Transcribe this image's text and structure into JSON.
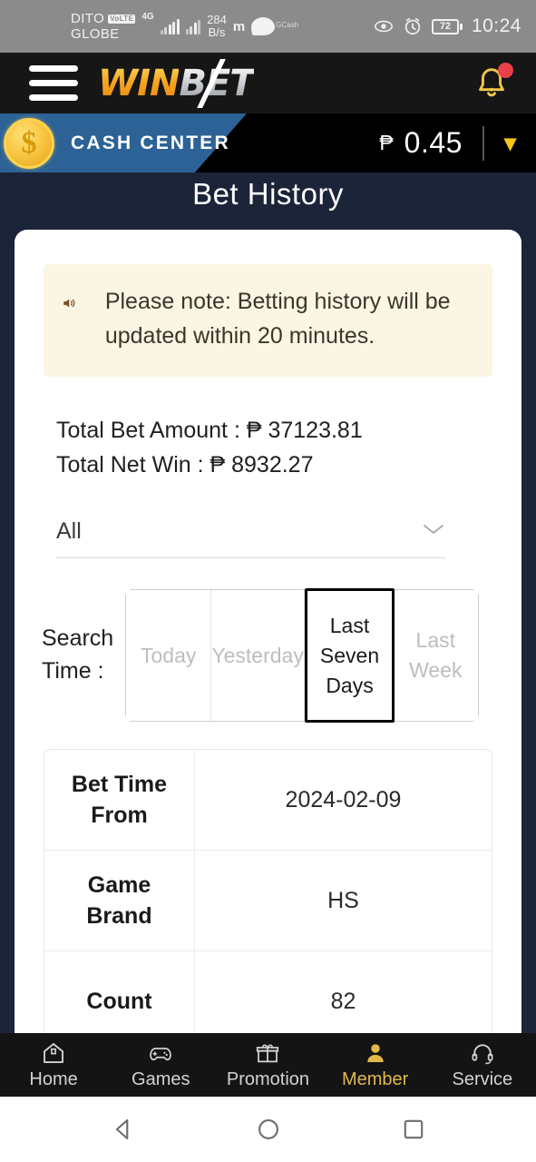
{
  "statusbar": {
    "carrier_primary": "DITO",
    "carrier_secondary": "GLOBE",
    "volte_badge": "VoLTE",
    "network_type": "4G",
    "data_rate": "284",
    "data_rate_unit": "B/s",
    "m_icon_label": "m",
    "gcash_label": "GCash",
    "battery_percent": "72",
    "time": "10:24",
    "icons": {
      "eye": "eye-icon",
      "alarm": "alarm-clock-icon",
      "battery": "battery-icon"
    }
  },
  "header": {
    "menu_icon": "hamburger-menu-icon",
    "logo_part1": "WIN",
    "logo_part2": "BET",
    "bell_icon": "notification-bell-icon",
    "has_notification": true
  },
  "cash_center": {
    "label": "CASH CENTER",
    "coin_symbol": "$",
    "currency_symbol": "₱",
    "balance": "0.45",
    "chevron": "▾"
  },
  "page": {
    "title": "Bet History"
  },
  "notice": {
    "icon": "speaker-announcement-icon",
    "text": "Please note: Betting history will be updated within 20 minutes."
  },
  "totals": {
    "bet_amount_line": "Total Bet Amount : ₱ 37123.81",
    "net_win_line": "Total Net Win : ₱ 8932.27",
    "bet_amount_label": "Total Bet Amount",
    "bet_amount_value": "37123.81",
    "net_win_label": "Total Net Win",
    "net_win_value": "8932.27"
  },
  "filter": {
    "selected": "All",
    "chevron": "⌄"
  },
  "search_time": {
    "label": "Search Time :",
    "options": [
      {
        "label": "Today",
        "active": false
      },
      {
        "label": "Yesterday",
        "active": false
      },
      {
        "label": "Last Seven Days",
        "active": true
      },
      {
        "label": "Last Week",
        "active": false
      }
    ]
  },
  "table": {
    "rows": [
      {
        "header": "Bet Time From",
        "value": "2024-02-09"
      },
      {
        "header": "Game Brand",
        "value": "HS"
      },
      {
        "header": "Count",
        "value": "82"
      }
    ]
  },
  "bottom_nav": {
    "items": [
      {
        "label": "Home",
        "icon": "home-icon",
        "active": false
      },
      {
        "label": "Games",
        "icon": "gamepad-icon",
        "active": false
      },
      {
        "label": "Promotion",
        "icon": "gift-icon",
        "active": false
      },
      {
        "label": "Member",
        "icon": "user-icon",
        "active": true
      },
      {
        "label": "Service",
        "icon": "headset-icon",
        "active": false
      }
    ]
  },
  "android_nav": {
    "back": "back-triangle-icon",
    "home": "home-circle-icon",
    "recents": "recents-square-icon"
  },
  "colors": {
    "page_bg": "#1b2438",
    "header_bg": "#161616",
    "cash_blue": "#2c6296",
    "accent_gold": "#e0b94a",
    "notice_bg": "#fbf6e4",
    "notice_text": "#3d3529",
    "notification_dot": "#e8414b"
  }
}
